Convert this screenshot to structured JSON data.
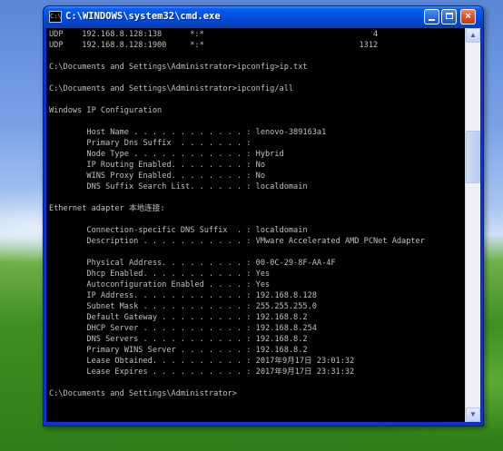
{
  "window": {
    "title": "C:\\WINDOWS\\system32\\cmd.exe",
    "icon_label": "C:\\",
    "buttons": {
      "minimize": "minimize",
      "maximize": "maximize",
      "close": "×"
    }
  },
  "scrollbar": {
    "up": "▲",
    "down": "▼"
  },
  "console": {
    "lines": [
      "UDP    192.168.8.128:138      *:*                                    4",
      "UDP    192.168.8.128:1900     *:*                                 1312",
      "",
      "C:\\Documents and Settings\\Administrator>ipconfig>ip.txt",
      "",
      "C:\\Documents and Settings\\Administrator>ipconfig/all",
      "",
      "Windows IP Configuration",
      "",
      "        Host Name . . . . . . . . . . . . : lenovo-389163a1",
      "        Primary Dns Suffix  . . . . . . . :",
      "        Node Type . . . . . . . . . . . . : Hybrid",
      "        IP Routing Enabled. . . . . . . . : No",
      "        WINS Proxy Enabled. . . . . . . . : No",
      "        DNS Suffix Search List. . . . . . : localdomain",
      "",
      "Ethernet adapter 本地连接:",
      "",
      "        Connection-specific DNS Suffix  . : localdomain",
      "        Description . . . . . . . . . . . : VMware Accelerated AMD PCNet Adapter",
      "",
      "        Physical Address. . . . . . . . . : 00-0C-29-8F-AA-4F",
      "        Dhcp Enabled. . . . . . . . . . . : Yes",
      "        Autoconfiguration Enabled . . . . : Yes",
      "        IP Address. . . . . . . . . . . . : 192.168.8.128",
      "        Subnet Mask . . . . . . . . . . . : 255.255.255.0",
      "        Default Gateway . . . . . . . . . : 192.168.8.2",
      "        DHCP Server . . . . . . . . . . . : 192.168.8.254",
      "        DNS Servers . . . . . . . . . . . : 192.168.8.2",
      "        Primary WINS Server . . . . . . . : 192.168.8.2",
      "        Lease Obtained. . . . . . . . . . : 2017年9月17日 23:01:32",
      "        Lease Expires . . . . . . . . . . : 2017年9月17日 23:31:32",
      "",
      "C:\\Documents and Settings\\Administrator>"
    ]
  }
}
